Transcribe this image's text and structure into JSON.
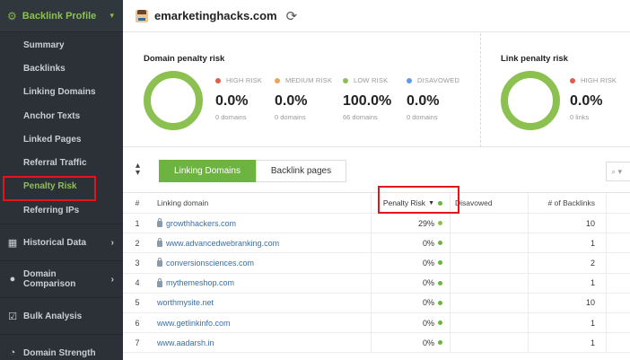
{
  "sidebar": {
    "header": "Backlink Profile",
    "items": [
      {
        "label": "Summary"
      },
      {
        "label": "Backlinks"
      },
      {
        "label": "Linking Domains"
      },
      {
        "label": "Anchor Texts"
      },
      {
        "label": "Linked Pages"
      },
      {
        "label": "Referral Traffic"
      },
      {
        "label": "Penalty Risk"
      },
      {
        "label": "Referring IPs"
      }
    ],
    "sections": [
      {
        "label": "Historical Data"
      },
      {
        "label": "Domain Comparison"
      },
      {
        "label": "Bulk Analysis"
      },
      {
        "label": "Domain Strength"
      }
    ]
  },
  "header": {
    "domain": "emarketinghacks.com"
  },
  "domain_risk": {
    "title": "Domain penalty risk",
    "metrics": [
      {
        "label": "HIGH RISK",
        "value": "0.0%",
        "sub": "0 domains",
        "color": "#e35b4a"
      },
      {
        "label": "MEDIUM RISK",
        "value": "0.0%",
        "sub": "0 domains",
        "color": "#f0a25a"
      },
      {
        "label": "LOW RISK",
        "value": "100.0%",
        "sub": "66 domains",
        "color": "#8cc152"
      },
      {
        "label": "DISAVOWED",
        "value": "0.0%",
        "sub": "0 domains",
        "color": "#5d9cec"
      }
    ]
  },
  "link_risk": {
    "title": "Link penalty risk",
    "metrics": [
      {
        "label": "HIGH RISK",
        "value": "0.0%",
        "sub": "0 links",
        "color": "#e35b4a"
      }
    ]
  },
  "tabs": {
    "active": "Linking Domains",
    "inactive": "Backlink pages"
  },
  "table": {
    "headers": {
      "num": "#",
      "domain": "Linking domain",
      "risk": "Penalty Risk",
      "disavowed": "Disavowed",
      "backlinks": "# of Backlinks"
    },
    "rows": [
      {
        "num": "1",
        "domain": "growthhackers.com",
        "secure": true,
        "risk": "29%",
        "backlinks": "10"
      },
      {
        "num": "2",
        "domain": "www.advancedwebranking.com",
        "secure": true,
        "risk": "0%",
        "backlinks": "1"
      },
      {
        "num": "3",
        "domain": "conversionsciences.com",
        "secure": true,
        "risk": "0%",
        "backlinks": "2"
      },
      {
        "num": "4",
        "domain": "mythemeshop.com",
        "secure": true,
        "risk": "0%",
        "backlinks": "1"
      },
      {
        "num": "5",
        "domain": "worthmysite.net",
        "secure": false,
        "risk": "0%",
        "backlinks": "10"
      },
      {
        "num": "6",
        "domain": "www.getlinkinfo.com",
        "secure": false,
        "risk": "0%",
        "backlinks": "1"
      },
      {
        "num": "7",
        "domain": "www.aadarsh.in",
        "secure": false,
        "risk": "0%",
        "backlinks": "1"
      }
    ]
  }
}
